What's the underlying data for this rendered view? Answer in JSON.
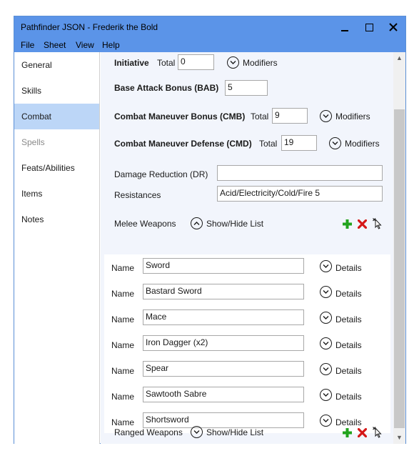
{
  "window": {
    "title": "Pathfinder JSON - Frederik the Bold",
    "controls": {
      "minimize_icon": "minimize-icon",
      "maximize_icon": "maximize-icon",
      "close_icon": "close-icon"
    }
  },
  "menu": [
    "File",
    "Sheet",
    "View",
    "Help"
  ],
  "sidebar": {
    "items": [
      {
        "label": "General"
      },
      {
        "label": "Skills"
      },
      {
        "label": "Combat",
        "selected": true
      },
      {
        "label": "Spells",
        "disabled": true
      },
      {
        "label": "Feats/Abilities"
      },
      {
        "label": "Items"
      },
      {
        "label": "Notes"
      }
    ]
  },
  "combat": {
    "initiative": {
      "label": "Initiative",
      "total_label": "Total",
      "total": "0",
      "modifiers_label": "Modifiers"
    },
    "bab": {
      "label": "Base Attack Bonus (BAB)",
      "value": "5"
    },
    "cmb": {
      "label": "Combat Maneuver Bonus (CMB)",
      "total_label": "Total",
      "total": "9",
      "modifiers_label": "Modifiers"
    },
    "cmd": {
      "label": "Combat Maneuver Defense (CMD)",
      "total_label": "Total",
      "total": "19",
      "modifiers_label": "Modifiers"
    },
    "dr": {
      "label": "Damage Reduction (DR)",
      "value": ""
    },
    "resistances": {
      "label": "Resistances",
      "value": "Acid/Electricity/Cold/Fire 5"
    }
  },
  "melee": {
    "label": "Melee Weapons",
    "toggle_label": "Show/Hide List",
    "name_label": "Name",
    "details_label": "Details",
    "weapons": [
      "Sword",
      "Bastard Sword",
      "Mace",
      "Iron Dagger (x2)",
      "Spear",
      "Sawtooth Sabre",
      "Shortsword"
    ]
  },
  "ranged": {
    "label": "Ranged Weapons",
    "toggle_label": "Show/Hide List"
  },
  "colors": {
    "titlebar": "#5b94e8",
    "selected": "#bcd6f7",
    "content_bg": "#f2f5fc",
    "add_green": "#22a31d",
    "delete_red": "#d51818"
  }
}
